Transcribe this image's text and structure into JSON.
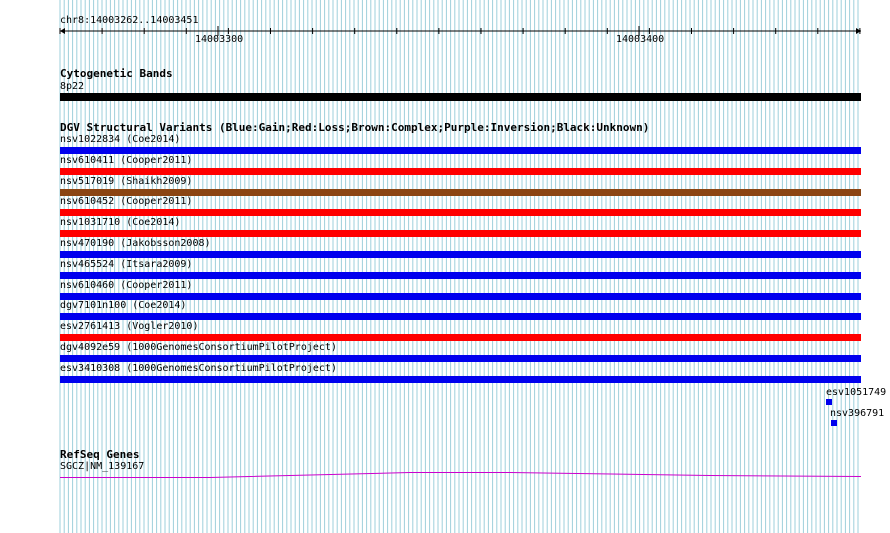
{
  "ruler": {
    "range": "chr8:14003262..14003451",
    "ticks": [
      "14003300",
      "14003400"
    ]
  },
  "colors": {
    "gain": "#0000ee",
    "loss": "#ff0000",
    "complex": "#8b4513",
    "band": "#000000",
    "gene": "#cc00cc",
    "grid_line": "#9ecfdb"
  },
  "cyto": {
    "title": "Cytogenetic Bands",
    "band_label": "8p22"
  },
  "dgv": {
    "title": "DGV Structural Variants (Blue:Gain;Red:Loss;Brown:Complex;Purple:Inversion;Black:Unknown)",
    "items": [
      {
        "label": "nsv1022834 (Coe2014)",
        "type": "gain"
      },
      {
        "label": "nsv610411 (Cooper2011)",
        "type": "loss"
      },
      {
        "label": "nsv517019 (Shaikh2009)",
        "type": "complex"
      },
      {
        "label": "nsv610452 (Cooper2011)",
        "type": "loss"
      },
      {
        "label": "nsv1031710 (Coe2014)",
        "type": "loss"
      },
      {
        "label": "nsv470190 (Jakobsson2008)",
        "type": "gain"
      },
      {
        "label": "nsv465524 (Itsara2009)",
        "type": "gain"
      },
      {
        "label": "nsv610460 (Cooper2011)",
        "type": "gain"
      },
      {
        "label": "dgv7101n100 (Coe2014)",
        "type": "gain"
      },
      {
        "label": "esv2761413 (Vogler2010)",
        "type": "loss"
      },
      {
        "label": "dgv4092e59 (1000GenomesConsortiumPilotProject)",
        "type": "gain"
      },
      {
        "label": "esv3410308 (1000GenomesConsortiumPilotProject)",
        "type": "gain"
      }
    ],
    "edge_items": [
      {
        "label": "esv1051749",
        "type": "gain"
      },
      {
        "label": "nsv396791",
        "type": "gain"
      }
    ]
  },
  "refseq": {
    "title": "RefSeq Genes",
    "gene_label": "SGCZ|NM_139167"
  }
}
